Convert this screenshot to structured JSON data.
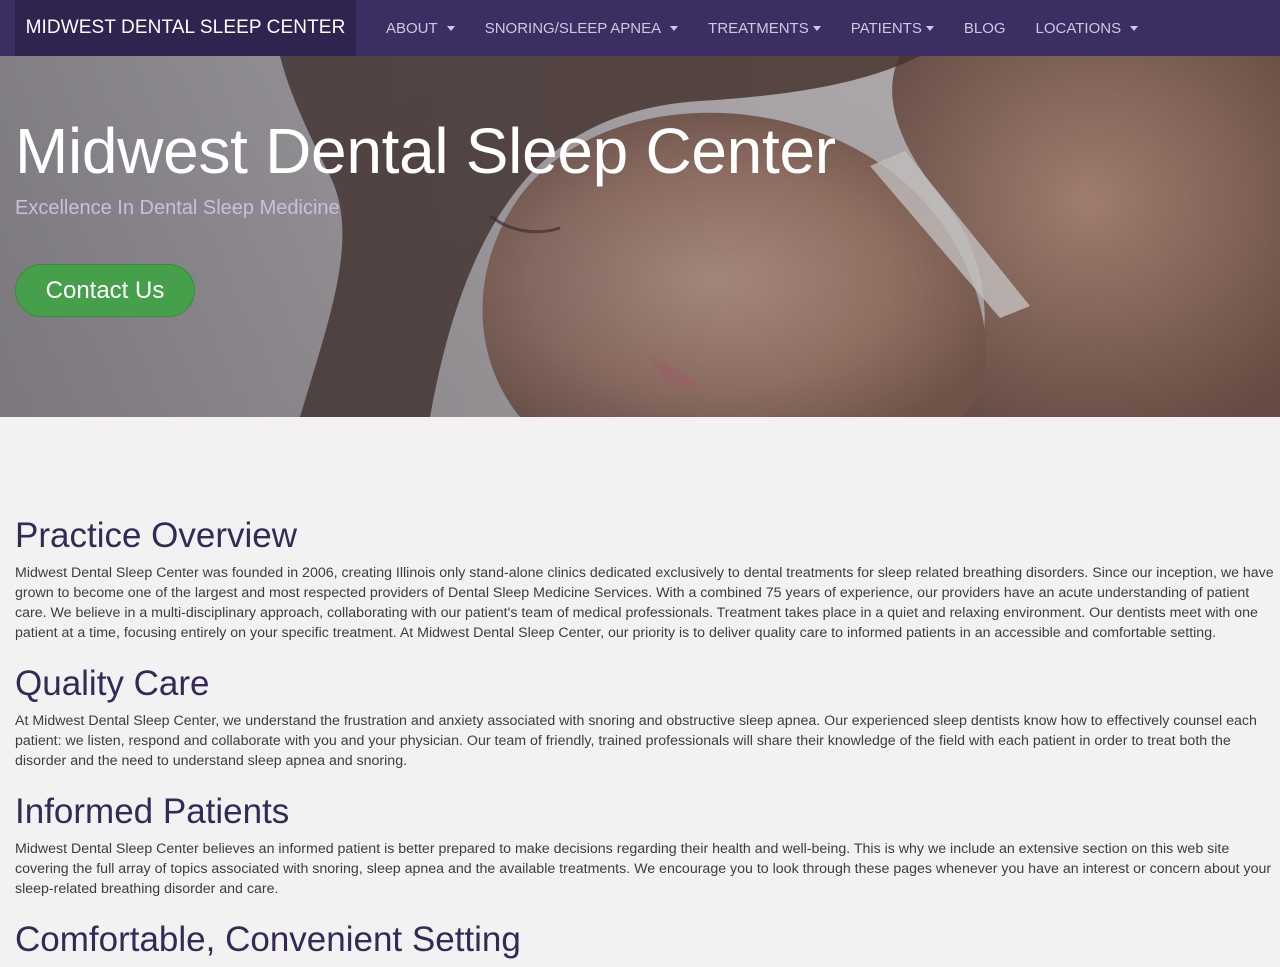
{
  "navbar": {
    "brand": "MIDWEST DENTAL SLEEP CENTER",
    "items": [
      {
        "label": "ABOUT",
        "dropdown": true
      },
      {
        "label": "SNORING/SLEEP APNEA",
        "dropdown": true
      },
      {
        "label": "TREATMENTS",
        "dropdown": true
      },
      {
        "label": "PATIENTS",
        "dropdown": true
      },
      {
        "label": "BLOG",
        "dropdown": false
      },
      {
        "label": "LOCATIONS",
        "dropdown": true
      }
    ]
  },
  "hero": {
    "title": "Midwest Dental Sleep Center",
    "subtitle": "Excellence In Dental Sleep Medicine",
    "cta_label": "Contact Us"
  },
  "sections": [
    {
      "heading": "Practice Overview",
      "body": "Midwest Dental Sleep Center was founded in 2006, creating Illinois only stand-alone clinics dedicated exclusively to dental treatments for sleep related breathing disorders. Since our inception, we have grown to become one of the largest and most respected providers of Dental Sleep Medicine Services. With a combined 75 years of experience, our providers have an acute understanding of patient care. We believe in a multi-disciplinary approach, collaborating with our patient's team of medical professionals. Treatment takes place in a quiet and relaxing environment. Our dentists meet with one patient at a time, focusing entirely on your specific treatment. At Midwest Dental Sleep Center, our priority is to deliver quality care to informed patients in an accessible and comfortable setting."
    },
    {
      "heading": "Quality Care",
      "body": "At Midwest Dental Sleep Center, we understand the frustration and anxiety associated with snoring and obstructive sleep apnea. Our experienced sleep dentists know how to effectively counsel each patient: we listen, respond and collaborate with you and your physician. Our team of friendly, trained professionals will share their knowledge of the field with each patient in order to treat both the disorder and the need to understand sleep apnea and snoring."
    },
    {
      "heading": "Informed Patients",
      "body": "Midwest Dental Sleep Center believes an informed patient is better prepared to make decisions regarding their health and well-being. This is why we include an extensive section on this web site covering the full array of topics associated with snoring, sleep apnea and the available treatments. We encourage you to look through these pages whenever you have an interest or concern about your sleep-related breathing disorder and care."
    },
    {
      "heading": "Comfortable, Convenient Setting",
      "body": ""
    }
  ],
  "colors": {
    "navbar_bg": "#3c2d62",
    "brand_bg": "#2f234f",
    "nav_text": "#cfc8e3",
    "subtitle": "#c9bde8",
    "cta_bg": "#46a04b",
    "heading": "#332a55",
    "page_bg": "#f4f1f2"
  },
  "hero_image": "sleeping-woman-photo"
}
